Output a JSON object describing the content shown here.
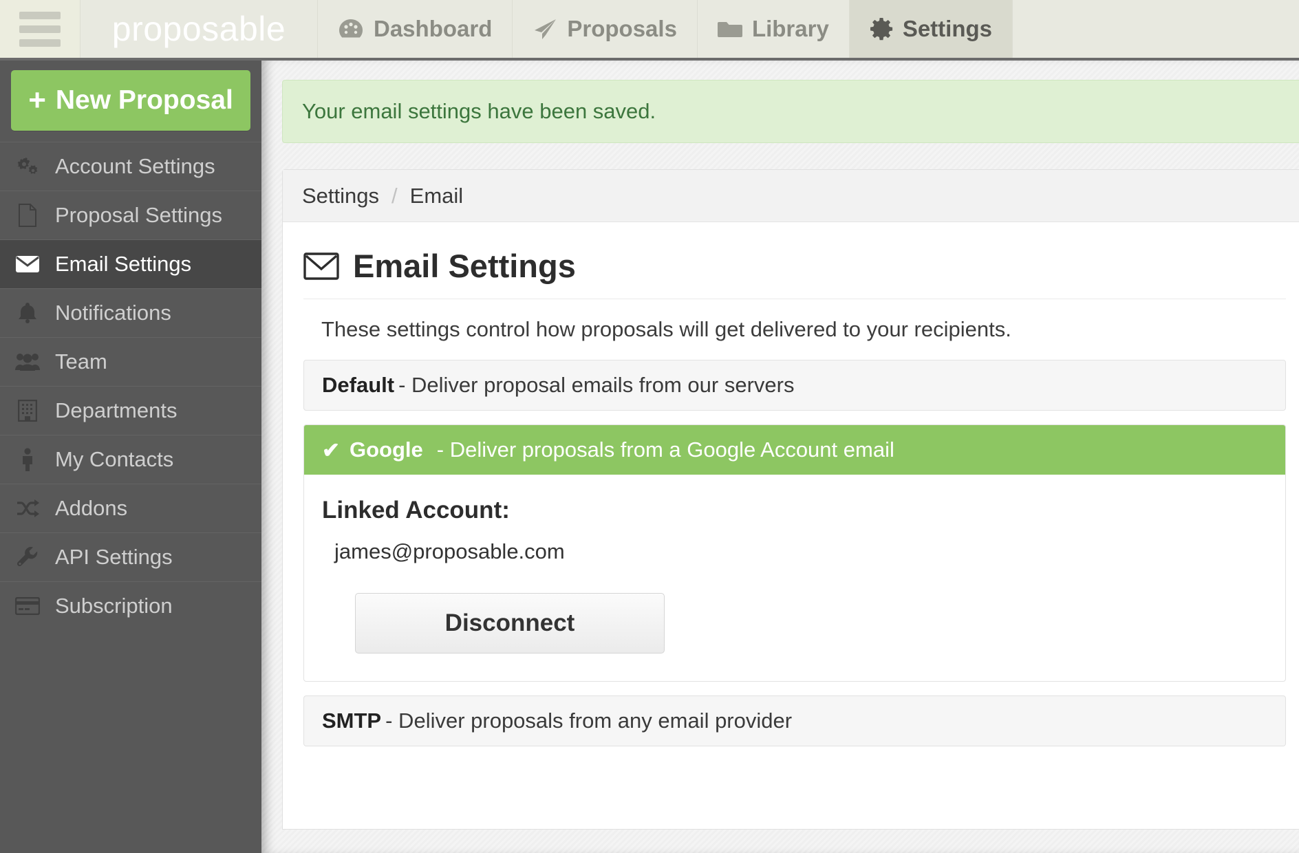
{
  "topbar": {
    "menu_icon": "hamburger-icon",
    "brand": "proposable",
    "tabs": [
      {
        "label": "Dashboard",
        "icon": "dashboard-gauge-icon",
        "active": false
      },
      {
        "label": "Proposals",
        "icon": "paper-plane-icon",
        "active": false
      },
      {
        "label": "Library",
        "icon": "folder-icon",
        "active": false
      },
      {
        "label": "Settings",
        "icon": "gear-icon",
        "active": true
      }
    ]
  },
  "sidebar": {
    "new_proposal_label": "New Proposal",
    "new_proposal_plus": "+",
    "items": [
      {
        "label": "Account Settings",
        "icon": "gears-icon",
        "active": false
      },
      {
        "label": "Proposal Settings",
        "icon": "document-icon",
        "active": false
      },
      {
        "label": "Email Settings",
        "icon": "envelope-icon",
        "active": true
      },
      {
        "label": "Notifications",
        "icon": "bell-icon",
        "active": false
      },
      {
        "label": "Team",
        "icon": "users-icon",
        "active": false
      },
      {
        "label": "Departments",
        "icon": "building-icon",
        "active": false
      },
      {
        "label": "My Contacts",
        "icon": "person-icon",
        "active": false
      },
      {
        "label": "Addons",
        "icon": "shuffle-icon",
        "active": false
      },
      {
        "label": "API Settings",
        "icon": "wrench-icon",
        "active": false
      },
      {
        "label": "Subscription",
        "icon": "credit-card-icon",
        "active": false
      }
    ]
  },
  "main": {
    "alert": "Your email settings have been saved.",
    "breadcrumb": {
      "parent": "Settings",
      "separator": "/",
      "current": "Email"
    },
    "page_title": "Email Settings",
    "page_title_icon": "envelope-icon",
    "lead_text": "These settings control how proposals will get delivered to your recipients.",
    "options": {
      "default": {
        "name": "Default",
        "description": "- Deliver proposal emails from our servers",
        "selected": false
      },
      "google": {
        "name": "Google",
        "description": "- Deliver proposals from a Google Account email",
        "selected": true,
        "check_glyph": "✔",
        "linked_account_label": "Linked Account:",
        "linked_account_email": "james@proposable.com",
        "disconnect_label": "Disconnect"
      },
      "smtp": {
        "name": "SMTP",
        "description": "- Deliver proposals from any email provider",
        "selected": false
      }
    }
  },
  "colors": {
    "brand_green": "#8dc662",
    "alert_bg": "#dff0d3",
    "alert_text": "#3c763d",
    "topbar_bg": "#e8e9e0",
    "sidebar_bg": "#585858",
    "sidebar_active_bg": "#474747"
  }
}
